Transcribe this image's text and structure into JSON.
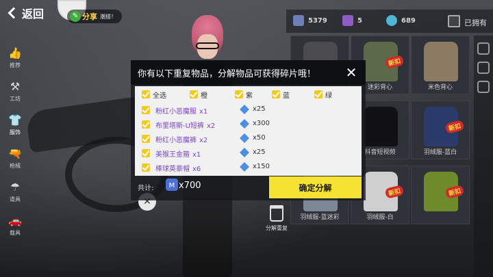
{
  "header": {
    "back_label": "返回",
    "share_label": "分享",
    "share_sub": "潮搭！"
  },
  "sidenav": [
    {
      "label": "推荐",
      "icon": "thumbs-up-icon",
      "glyph": "👍"
    },
    {
      "label": "工坊",
      "icon": "toolbox-icon",
      "glyph": "⚒"
    },
    {
      "label": "服饰",
      "icon": "clothes-icon",
      "glyph": "👕"
    },
    {
      "label": "枪械",
      "icon": "gun-icon",
      "glyph": "🔫"
    },
    {
      "label": "道具",
      "icon": "parachute-icon",
      "glyph": "☂"
    },
    {
      "label": "载具",
      "icon": "vehicle-icon",
      "glyph": "🚗"
    }
  ],
  "currency": {
    "shards": "5379",
    "coupons": "5",
    "diamonds": "689",
    "owned_label": "已拥有"
  },
  "grid": [
    {
      "name": "",
      "tag": "",
      "color": "#4b4b4f"
    },
    {
      "name": "迷彩背心",
      "tag": "新扣",
      "color": "#5c6a4a"
    },
    {
      "name": "米色背心",
      "tag": "",
      "color": "#8c7a62"
    },
    {
      "name": "",
      "tag": "新扣",
      "color": "#d9d9d9"
    },
    {
      "name": "抖音短视频",
      "tag": "",
      "color": "#111114"
    },
    {
      "name": "羽绒服-蓝白",
      "tag": "新扣",
      "color": "#2a3a6a"
    },
    {
      "name": "羽绒服-蓝迷彩",
      "tag": "",
      "color": "#7c8895"
    },
    {
      "name": "羽绒服-白",
      "tag": "新扣",
      "color": "#cfcfcf"
    },
    {
      "name": "",
      "tag": "新扣",
      "color": "#6f8a2a"
    }
  ],
  "side_tool": {
    "label": "分解重复"
  },
  "dialog": {
    "title": "你有以下重复物品，分解物品可获得碎片哦！",
    "filters": [
      {
        "label": "全选"
      },
      {
        "label": "橙"
      },
      {
        "label": "紫"
      },
      {
        "label": "蓝"
      },
      {
        "label": "绿"
      }
    ],
    "items": [
      {
        "name": "粉红小恶魔服",
        "qty": "x1",
        "shards": "x25"
      },
      {
        "name": "布里塔斯-U短裤",
        "qty": "x2",
        "shards": "x300"
      },
      {
        "name": "粉红小恶魔裤",
        "qty": "x2",
        "shards": "x50"
      },
      {
        "name": "美猴王金箍",
        "qty": "x1",
        "shards": "x25"
      },
      {
        "name": "棒球英豪帽",
        "qty": "x6",
        "shards": "x150"
      }
    ],
    "total_label": "共计:",
    "total_value": "x700",
    "confirm_label": "确定分解"
  },
  "colors": {
    "accent_yellow": "#f5e232",
    "checkbox": "#f4c91f",
    "item_purple": "#7b45c2"
  }
}
